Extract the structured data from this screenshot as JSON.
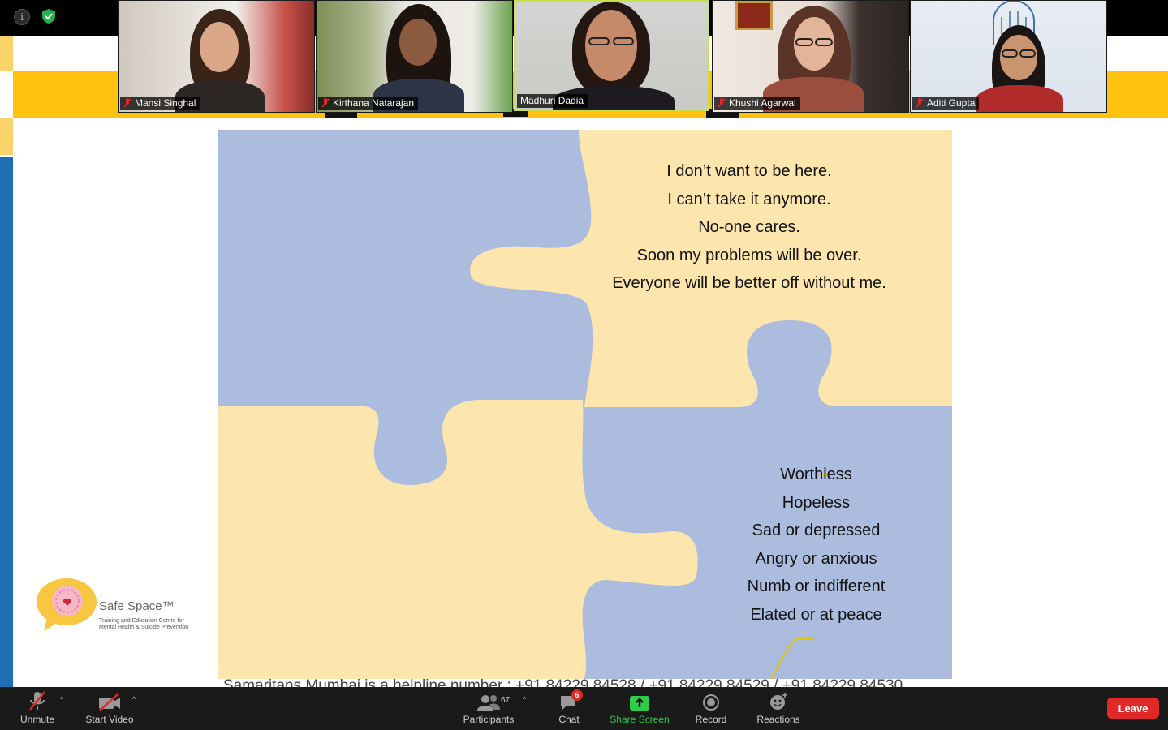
{
  "participants_tiles": [
    {
      "name": "Mansi Singhal",
      "muted": true
    },
    {
      "name": "Kirthana Natarajan",
      "muted": true
    },
    {
      "name": "Madhuri Dadia",
      "muted": false
    },
    {
      "name": "Khushi Agarwal",
      "muted": true
    },
    {
      "name": "Aditi Gupta",
      "muted": true
    }
  ],
  "slide": {
    "top_lines": [
      "I don’t want to be here.",
      "I can’t take it anymore.",
      "No-one cares.",
      "Soon my problems will be over.",
      "Everyone will be better off without me."
    ],
    "bottom_lines": [
      "Worthless",
      "Hopeless",
      "Sad or depressed",
      "Angry or anxious",
      "Numb or indifferent",
      "Elated or at peace"
    ],
    "helpline": "Samaritans Mumbai is a helpline number : +91 84229 84528 / +91 84229 84529 / +91 84229 84530",
    "logo_name": "Safe Space™",
    "logo_tagline": "Training and Education Centre for Mental Health & Suicide Prevention",
    "colors": {
      "blue_piece": "#abbcdf",
      "yellow_piece": "#fde5ae",
      "band": "#ffc20e",
      "side_blue": "#1f6fb5"
    }
  },
  "toolbar": {
    "unmute": "Unmute",
    "start_video": "Start Video",
    "participants": "Participants",
    "participants_count": "67",
    "chat": "Chat",
    "chat_badge": "6",
    "share_screen": "Share Screen",
    "record": "Record",
    "reactions": "Reactions",
    "leave": "Leave"
  },
  "icons": [
    "info-icon",
    "shield-check-icon",
    "mic-muted-icon",
    "video-off-icon",
    "participants-icon",
    "chat-icon",
    "share-screen-icon",
    "record-icon",
    "reactions-icon"
  ]
}
